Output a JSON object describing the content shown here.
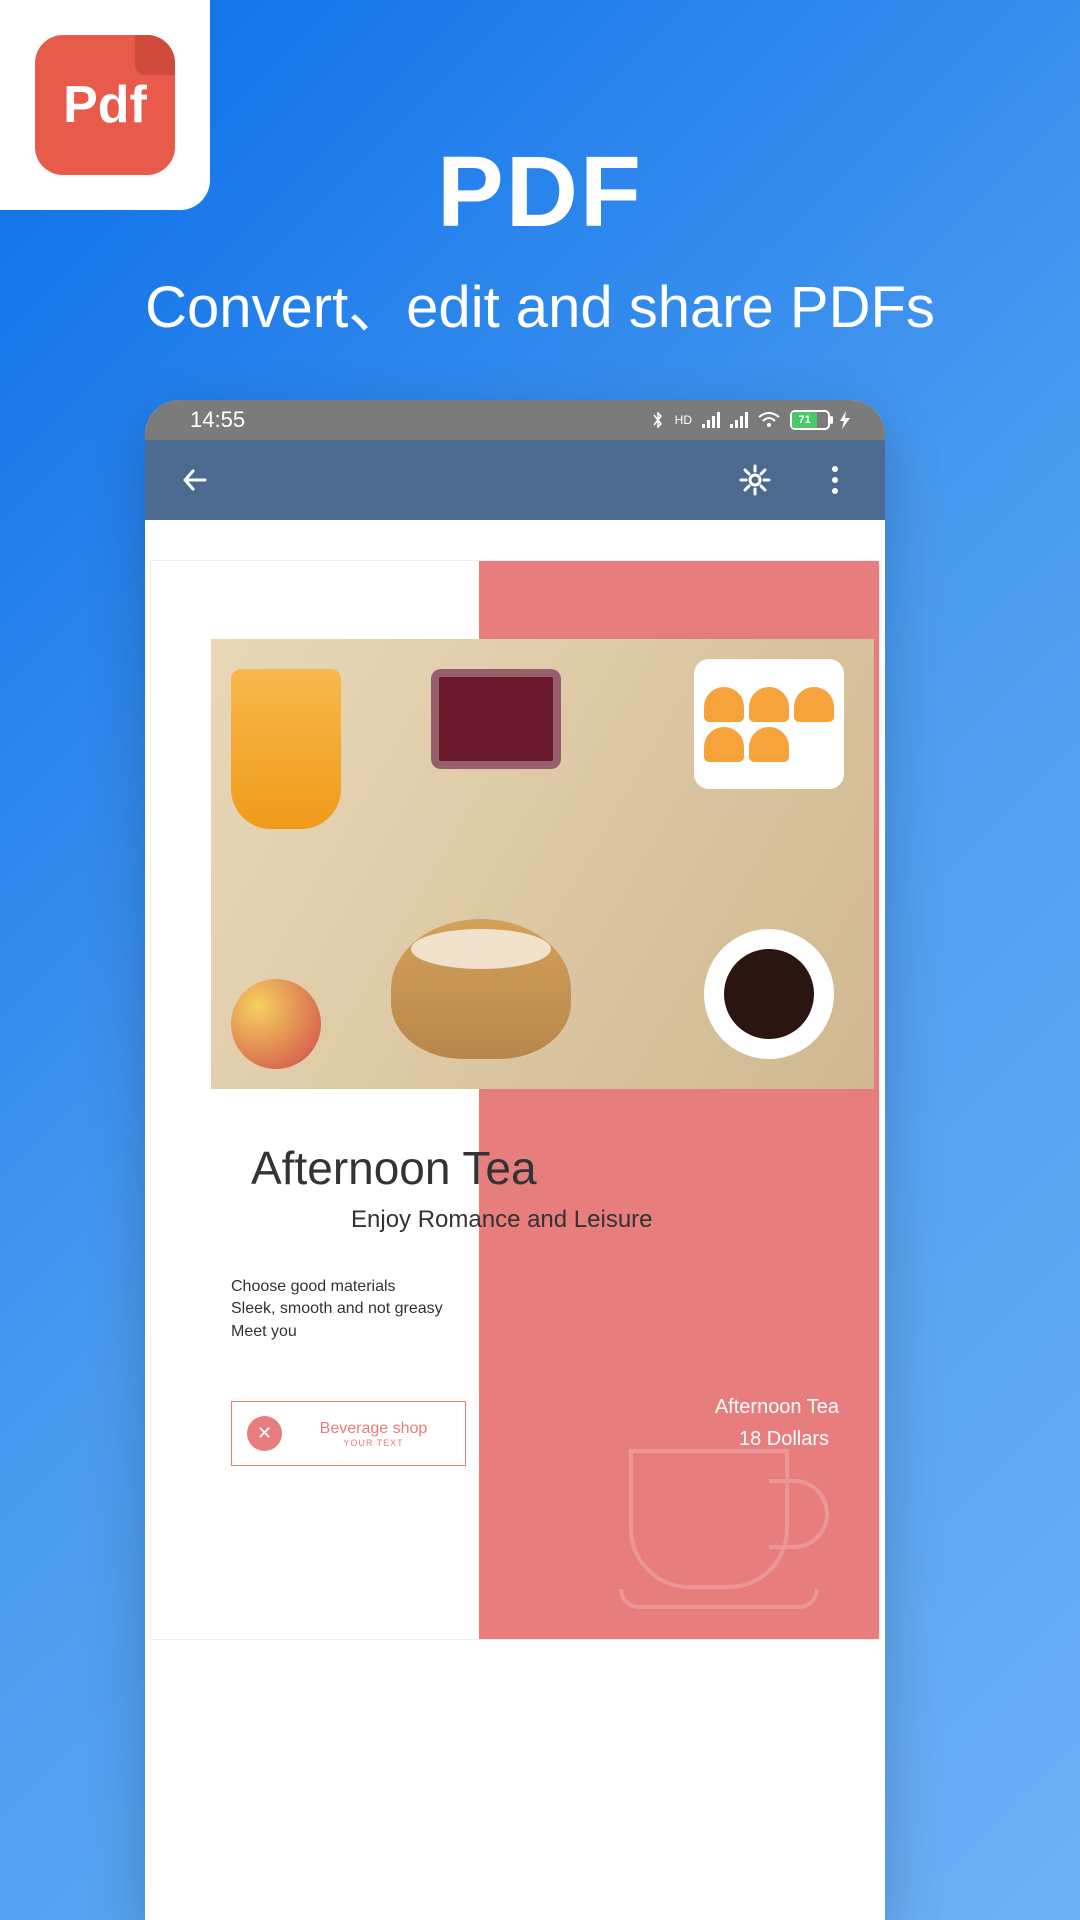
{
  "badge": {
    "label": "Pdf"
  },
  "hero": {
    "title": "PDF",
    "subtitle": "Convert、edit and share PDFs"
  },
  "statusbar": {
    "time": "14:55",
    "battery": "71"
  },
  "document": {
    "title": "Afternoon Tea",
    "subtitle": "Enjoy Romance and Leisure",
    "line1": "Choose good materials",
    "line2": "Sleek, smooth and not greasy",
    "line3": "Meet you",
    "beverage_label": "Beverage shop",
    "beverage_small": "YOUR TEXT",
    "price_title": "Afternoon Tea",
    "price_value": "18 Dollars"
  }
}
